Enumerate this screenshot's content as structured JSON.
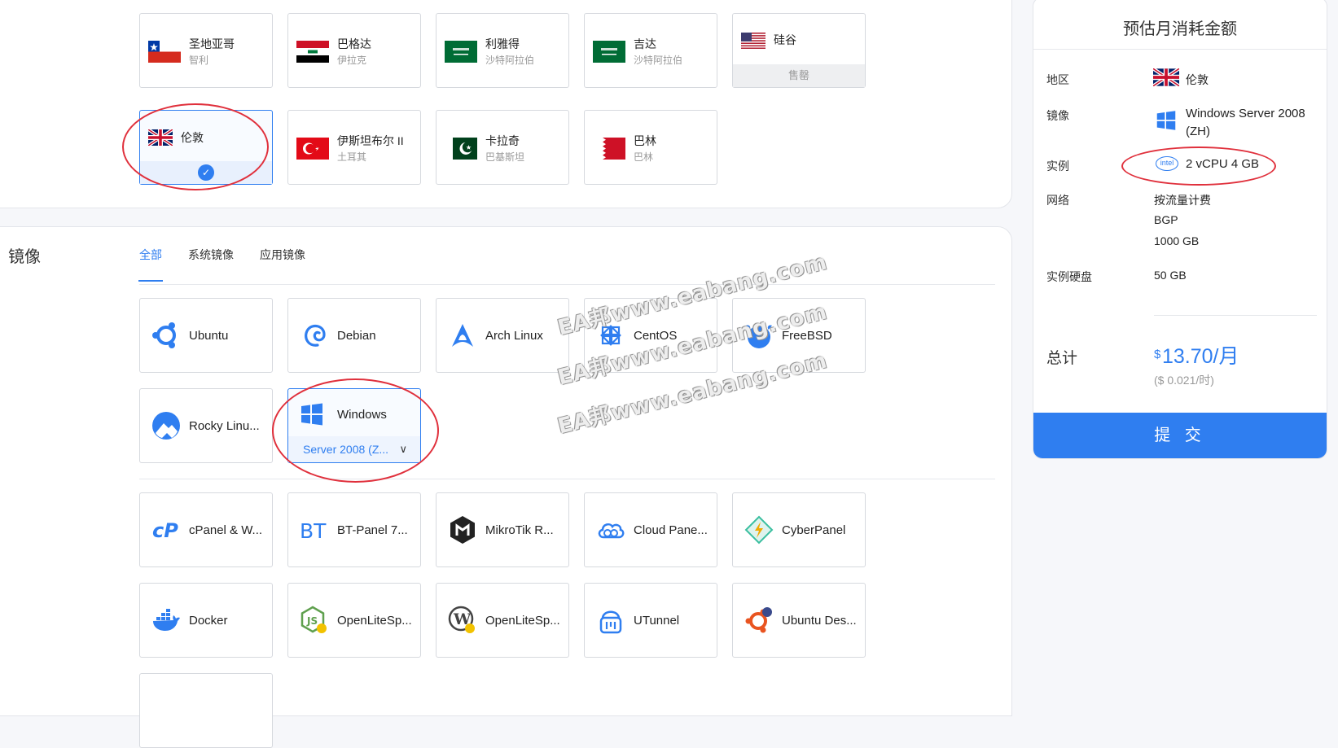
{
  "locations": [
    {
      "name": "圣地亚哥",
      "country": "智利",
      "flag": "chile",
      "status": ""
    },
    {
      "name": "巴格达",
      "country": "伊拉克",
      "flag": "iraq",
      "status": ""
    },
    {
      "name": "利雅得",
      "country": "沙特阿拉伯",
      "flag": "saudi",
      "status": ""
    },
    {
      "name": "吉达",
      "country": "沙特阿拉伯",
      "flag": "saudi",
      "status": ""
    },
    {
      "name": "硅谷",
      "country": "",
      "flag": "usa",
      "status": "售罄"
    },
    {
      "name": "伦敦",
      "country": "",
      "flag": "uk",
      "status": "selected"
    },
    {
      "name": "伊斯坦布尔 II",
      "country": "土耳其",
      "flag": "turkey",
      "status": ""
    },
    {
      "name": "卡拉奇",
      "country": "巴基斯坦",
      "flag": "pakistan",
      "status": ""
    },
    {
      "name": "巴林",
      "country": "巴林",
      "flag": "bahrain",
      "status": ""
    }
  ],
  "image_section": {
    "title": "镜像",
    "tabs": [
      {
        "label": "全部",
        "active": true
      },
      {
        "label": "系统镜像",
        "active": false
      },
      {
        "label": "应用镜像",
        "active": false
      }
    ]
  },
  "os_images": [
    {
      "name": "Ubuntu",
      "icon": "ubuntu-icon"
    },
    {
      "name": "Debian",
      "icon": "debian-icon"
    },
    {
      "name": "Arch Linux",
      "icon": "arch-icon"
    },
    {
      "name": "CentOS",
      "icon": "centos-icon"
    },
    {
      "name": "FreeBSD",
      "icon": "freebsd-icon"
    },
    {
      "name": "Rocky Linu...",
      "icon": "rocky-icon"
    },
    {
      "name": "Windows",
      "icon": "windows-icon",
      "version": "Server 2008 (Z...",
      "selected": true
    }
  ],
  "app_images": [
    {
      "name": "cPanel & W...",
      "icon": "cpanel-icon"
    },
    {
      "name": "BT-Panel 7...",
      "icon": "btpanel-icon"
    },
    {
      "name": "MikroTik R...",
      "icon": "mikrotik-icon"
    },
    {
      "name": "Cloud Pane...",
      "icon": "cloudpanel-icon"
    },
    {
      "name": "CyberPanel",
      "icon": "cyberpanel-icon"
    },
    {
      "name": "Docker",
      "icon": "docker-icon"
    },
    {
      "name": "OpenLiteSp...",
      "icon": "openlitespeed-node-icon"
    },
    {
      "name": "OpenLiteSp...",
      "icon": "openlitespeed-wordpress-icon"
    },
    {
      "name": "UTunnel",
      "icon": "utunnel-icon"
    },
    {
      "name": "Ubuntu Des...",
      "icon": "ubuntu-desktop-icon"
    }
  ],
  "watermark": "EA邦www.eabang.com",
  "summary": {
    "title": "预估月消耗金额",
    "region_label": "地区",
    "region_value": "伦敦",
    "image_label": "镜像",
    "image_value_line1": "Windows Server 2008",
    "image_value_line2": "(ZH)",
    "instance_label": "实例",
    "instance_value": "2 vCPU 4 GB",
    "cpu_brand": "intel",
    "network_label": "网络",
    "network_billing": "按流量计费",
    "network_type": "BGP",
    "network_traffic": "1000 GB",
    "disk_label": "实例硬盘",
    "disk_value": "50 GB",
    "total_label": "总计",
    "currency": "$",
    "total_value": "13.70/月",
    "hourly": "($ 0.021/时)",
    "submit_label": "提 交"
  },
  "colors": {
    "accent": "#2f7ef0",
    "annotation": "#e0303c"
  }
}
